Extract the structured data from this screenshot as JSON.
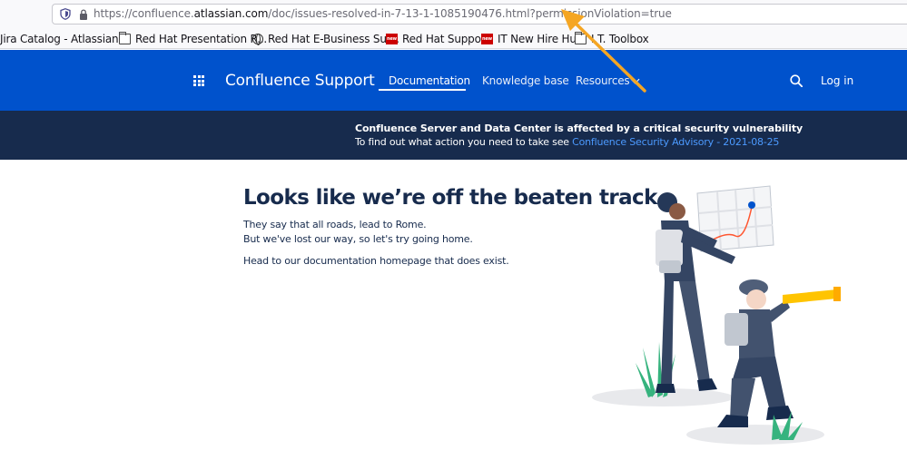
{
  "browser": {
    "url_prefix": "https://confluence.",
    "url_host": "atlassian.com",
    "url_suffix": "/doc/issues-resolved-in-7-13-1-1085190476.html?permissionViolation=true",
    "bookmarks": [
      {
        "label": "Jira Catalog - Atlassian ...",
        "icon": "none"
      },
      {
        "label": "Red Hat Presentation R...",
        "icon": "folder-icon"
      },
      {
        "label": "Red Hat E-Business Sui...",
        "icon": "globe-icon"
      },
      {
        "label": "Red Hat Support",
        "icon": "redhat-icon"
      },
      {
        "label": "IT New Hire Hub",
        "icon": "redhat-icon"
      },
      {
        "label": "I.T. Toolbox",
        "icon": "folder-icon"
      }
    ]
  },
  "nav": {
    "brand": "Confluence Support",
    "links": [
      "Documentation",
      "Knowledge base",
      "Resources"
    ],
    "login": "Log in",
    "color": "#0052cc"
  },
  "banner": {
    "title": "Confluence Server and Data Center is affected by a critical security vulnerability",
    "text": "To find out what action you need to take see ",
    "link": "Confluence Security Advisory - 2021-08-25",
    "color": "#172b4d"
  },
  "main": {
    "headline": "Looks like we’re off the beaten track",
    "line1": "They say that all roads, lead to Rome.",
    "line2": "But we've lost our way, so let's try going home.",
    "line3": "Head to our documentation homepage that does exist."
  },
  "annotation_color": "#f5a623"
}
